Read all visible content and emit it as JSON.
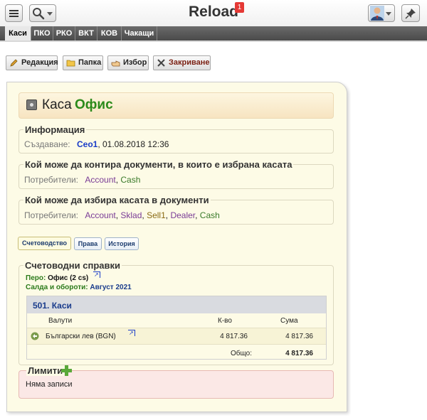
{
  "header": {
    "app_title": "Reload",
    "notification_count": "1",
    "icons": [
      "hamburger-menu-icon",
      "search-icon",
      "user-avatar-icon",
      "pin-icon"
    ]
  },
  "tabs": [
    {
      "label": "Каси",
      "active": true
    },
    {
      "label": "ПКО",
      "active": false
    },
    {
      "label": "РКО",
      "active": false
    },
    {
      "label": "ВКТ",
      "active": false
    },
    {
      "label": "КОВ",
      "active": false
    },
    {
      "label": "Чакащи",
      "active": false
    }
  ],
  "toolbar": {
    "edit_label": "Редакция",
    "folder_label": "Папка",
    "select_label": "Избор",
    "close_label": "Закриване"
  },
  "record": {
    "type_label": "Каса",
    "name": "Офис"
  },
  "info": {
    "legend": "Информация",
    "created_label": "Създаване:",
    "created_by": "Ceo1",
    "created_at": ", 01.08.2018 12:36"
  },
  "contiring": {
    "legend": "Кой може да контира документи, в които е избрана касата",
    "users_label": "Потребители:",
    "users": [
      "Account",
      "Cash"
    ]
  },
  "selecting": {
    "legend": "Кой може да избира касата в документи",
    "users_label": "Потребители:",
    "users": [
      "Account",
      "Sklad",
      "Sell1",
      "Dealer",
      "Cash"
    ]
  },
  "subtabs": [
    {
      "label": "Счетоводство",
      "active": true
    },
    {
      "label": "Права",
      "active": false
    },
    {
      "label": "История",
      "active": false
    }
  ],
  "accounting": {
    "legend": "Счетоводни справки",
    "pero_label": "Перо:",
    "pero_value": "Офис (2 cs)",
    "balances_label": "Салда и обороти:",
    "balances_value": "Август 2021",
    "table": {
      "title": "501. Каси",
      "headers": [
        "Валути",
        "К-во",
        "Сума"
      ],
      "rows": [
        {
          "currency": "Български лев (BGN)",
          "qty": "4 817.36",
          "amount": "4 817.36"
        }
      ],
      "total_label": "Общо:",
      "total_value": "4 817.36"
    }
  },
  "limits": {
    "legend": "Лимити",
    "empty_text": "Няма записи"
  },
  "colors": {
    "panel_bg": "#fdfbe6",
    "record_name": "#2b8a1a",
    "link_blue": "#1a3cc8",
    "link_purple": "#7a3c96",
    "limits_bg": "#fbe8e6"
  }
}
